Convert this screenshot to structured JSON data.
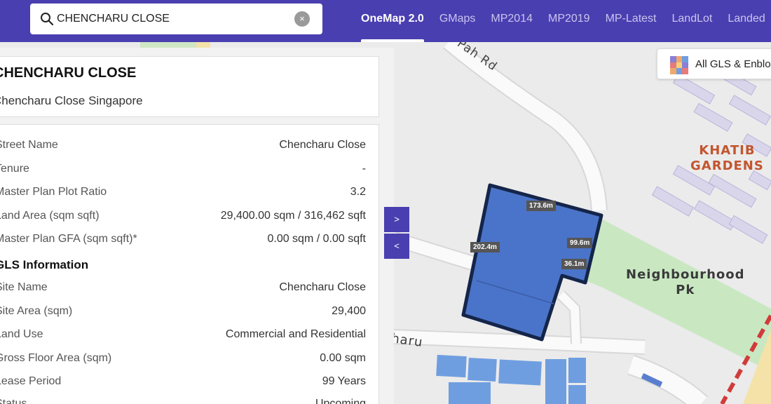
{
  "search": {
    "value": "CHENCHARU CLOSE",
    "clear_symbol": "×"
  },
  "nav": {
    "tabs": [
      {
        "label": "OneMap 2.0",
        "active": true
      },
      {
        "label": "GMaps",
        "active": false
      },
      {
        "label": "MP2014",
        "active": false
      },
      {
        "label": "MP2019",
        "active": false
      },
      {
        "label": "MP-Latest",
        "active": false
      },
      {
        "label": "LandLot",
        "active": false
      },
      {
        "label": "Landed",
        "active": false
      }
    ]
  },
  "layer_button": {
    "label": "All GLS & Enblo"
  },
  "panel": {
    "title": "CHENCHARU CLOSE",
    "address": "Chencharu Close Singapore",
    "rows": [
      {
        "key": "Street Name",
        "value": "Chencharu Close"
      },
      {
        "key": "Tenure",
        "value": "-"
      },
      {
        "key": "Master Plan Plot Ratio",
        "value": "3.2"
      },
      {
        "key": "Land Area (sqm sqft)",
        "value": "29,400.00 sqm / 316,462 sqft"
      },
      {
        "key": "Master Plan GFA (sqm sqft)*",
        "value": "0.00 sqm / 0.00 sqft"
      }
    ],
    "gls_heading": "GLS Information",
    "gls_rows": [
      {
        "key": "Site Name",
        "value": "Chencharu Close"
      },
      {
        "key": "Site Area (sqm)",
        "value": "29,400"
      },
      {
        "key": "Land Use",
        "value": "Commercial and Residential"
      },
      {
        "key": "Gross Floor Area (sqm)",
        "value": "0.00 sqm"
      },
      {
        "key": "Lease Period",
        "value": "99 Years"
      },
      {
        "key": "Status",
        "value": "Upcoming"
      }
    ]
  },
  "side_buttons": {
    "expand": ">",
    "collapse": "<"
  },
  "map": {
    "road_labels": {
      "pah": "Pah Rd",
      "chencharu": "haru"
    },
    "area_labels": {
      "khatib_line1": "KHATIB",
      "khatib_line2": "GARDENS",
      "park_line1": "Neighbourhood",
      "park_line2": "Pk"
    },
    "measurements": [
      "173.6m",
      "202.4m",
      "99.6m",
      "36.1m"
    ],
    "colors": {
      "parcel": "#4a74c9",
      "parcel_border": "#15254a",
      "park": "#c9e8c2",
      "pin": "#e0503a",
      "accent": "#4a3fb0"
    }
  }
}
